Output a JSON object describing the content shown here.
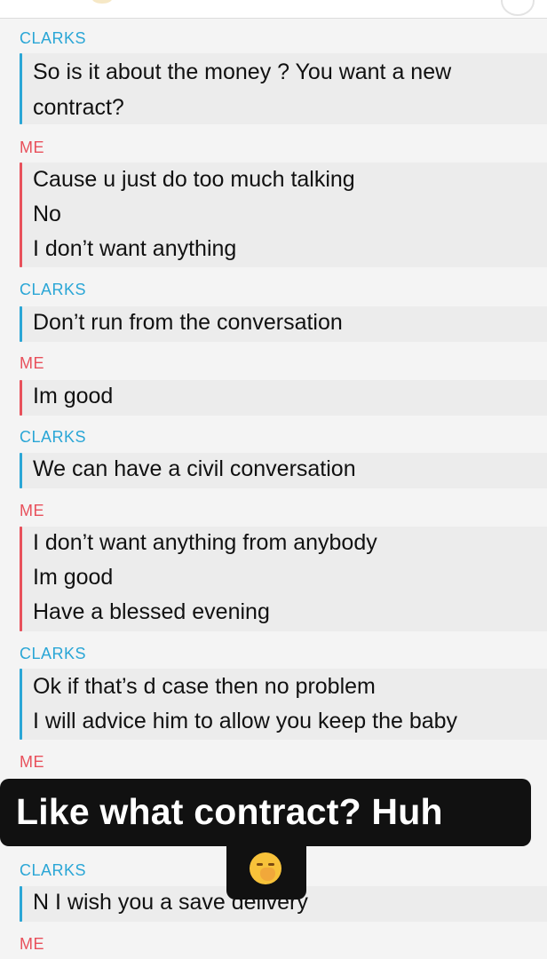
{
  "messages": [
    {
      "sender": "CLARKS",
      "lines": [
        "So is it about the money ? You want a new",
        "contract?"
      ]
    },
    {
      "sender": "ME",
      "lines": [
        "Cause u just do too much talking",
        "No",
        "I don’t want anything"
      ]
    },
    {
      "sender": "CLARKS",
      "lines": [
        "Don’t run from the conversation"
      ]
    },
    {
      "sender": "ME",
      "lines": [
        "Im good"
      ]
    },
    {
      "sender": "CLARKS",
      "lines": [
        "We can have a civil conversation"
      ]
    },
    {
      "sender": "ME",
      "lines": [
        "I don’t want anything from anybody",
        "Im good",
        "Have a blessed evening"
      ]
    },
    {
      "sender": "CLARKS",
      "lines": [
        "Ok if that’s d case then no problem",
        "I will advice him to allow you keep the baby"
      ]
    },
    {
      "sender": "ME",
      "lines": []
    },
    {
      "sender": "CLARKS",
      "lines": [
        "N I wish you a save delivery"
      ]
    },
    {
      "sender": "ME",
      "lines": []
    }
  ],
  "overlay": {
    "caption": "Like what contract? Huh",
    "emoji": "yawning-face-emoji"
  },
  "colors": {
    "clarks": "#2aa6d6",
    "me": "#e8505b",
    "overlay_bg": "#111111"
  }
}
